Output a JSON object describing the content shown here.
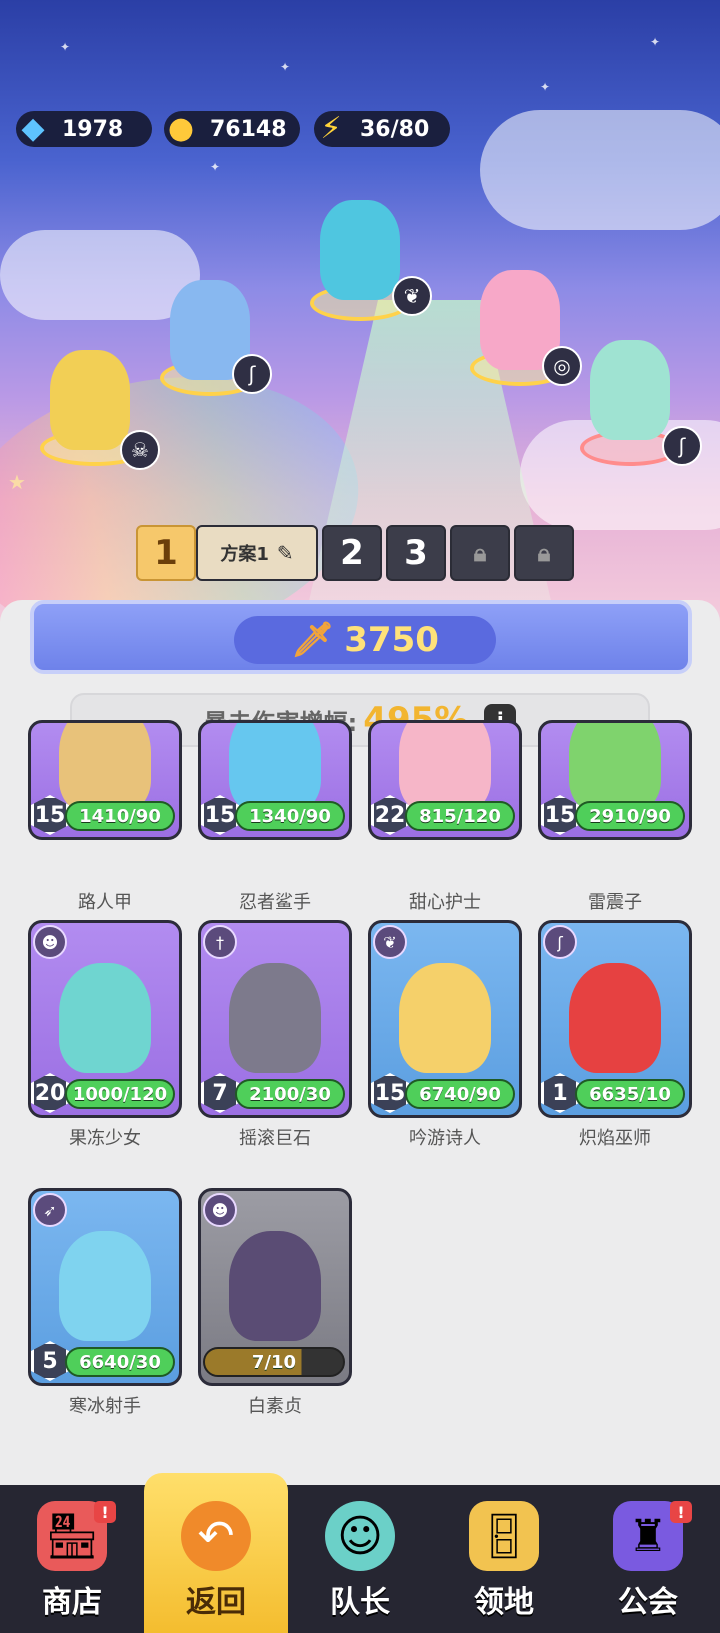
{
  "resources": {
    "gems": "1978",
    "gold": "76148",
    "energy": "36/80"
  },
  "formation_tabs": {
    "active_index": "1",
    "active_name": "方案1",
    "tab2": "2",
    "tab3": "3"
  },
  "power": "3750",
  "crit": {
    "label": "暴击伤害增幅:",
    "value": "495%"
  },
  "heroes": [
    {
      "name": "路人甲",
      "level": "15",
      "xp": "1410/90",
      "color": "purple",
      "cls": "🗡"
    },
    {
      "name": "忍者鲨手",
      "level": "15",
      "xp": "1340/90",
      "color": "purple",
      "cls": "✦"
    },
    {
      "name": "甜心护士",
      "level": "22",
      "xp": "815/120",
      "color": "purple",
      "cls": "✚"
    },
    {
      "name": "雷震子",
      "level": "15",
      "xp": "2910/90",
      "color": "purple",
      "cls": "⚡"
    },
    {
      "name": "果冻少女",
      "level": "20",
      "xp": "1000/120",
      "color": "purple",
      "cls": "☻"
    },
    {
      "name": "摇滚巨石",
      "level": "7",
      "xp": "2100/30",
      "color": "purple",
      "cls": "†"
    },
    {
      "name": "吟游诗人",
      "level": "15",
      "xp": "6740/90",
      "color": "blue",
      "cls": "❦"
    },
    {
      "name": "炽焰巫师",
      "level": "1",
      "xp": "6635/10",
      "color": "blue",
      "cls": "ʃ"
    },
    {
      "name": "寒冰射手",
      "level": "5",
      "xp": "6640/30",
      "color": "blue",
      "cls": "➶"
    },
    {
      "name": "白素贞",
      "level": "",
      "xp": "7/10",
      "color": "gray",
      "cls": "☻"
    }
  ],
  "nav": {
    "shop": "商店",
    "back": "返回",
    "captain": "队长",
    "territory": "领地",
    "guild": "公会"
  },
  "icons": {
    "gem": "gem-icon",
    "gold": "gold-coin-icon",
    "energy": "lightning-icon",
    "sword": "sword-icon",
    "edit": "edit-icon",
    "lock": "lock-icon",
    "info": "info-icon"
  }
}
